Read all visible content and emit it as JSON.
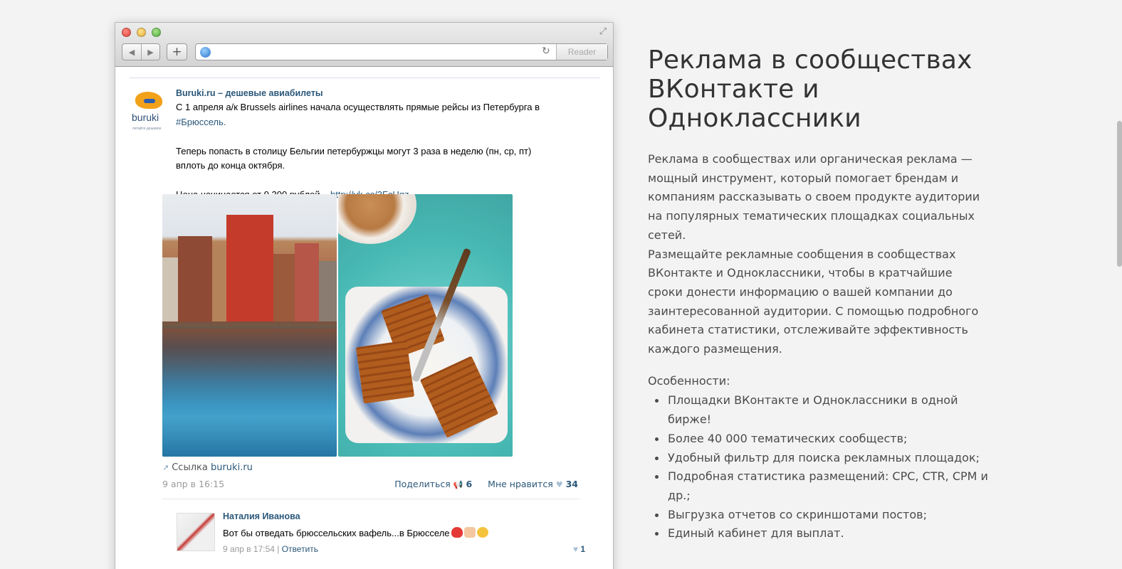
{
  "browser": {
    "reader_label": "Reader",
    "reload_icon": "reload-icon",
    "globe_icon": "globe-icon"
  },
  "post": {
    "author": "Buruki.ru – дешевые авиабилеты",
    "avatar_text": "buruki",
    "avatar_subtext": "летайте дешевле",
    "line1": "С 1 апреля а/к Brussels airlines начала осуществлять прямые рейсы из Петербурга в",
    "hashtag": "#Брюссель.",
    "line2a": "Теперь попасть в столицу Бельгии петербуржцы могут 3 раза в неделю (пн, ср, пт)",
    "line2b": "вплоть до конца октября.",
    "price_text": "Цена начинается от 9 300 рублей – ",
    "price_link": "http://vk.cc/3FcUqz",
    "link_label": "Ссылка ",
    "link_domain": "buruki.ru",
    "date": "9 апр в 16:15",
    "share_label": "Поделиться",
    "share_count": "6",
    "like_label": "Мне нравится",
    "like_count": "34"
  },
  "comment": {
    "author": "Наталия Иванова",
    "text": "Вот бы отведать брюссельских вафель...в Брюсселе",
    "date": "9 апр в 17:54 | ",
    "reply_label": "Ответить",
    "like_count": "1"
  },
  "content": {
    "title": "Реклама в сообществах ВКонтакте и Одноклассники",
    "paragraph1": "Реклама в сообществах или органическая реклама — мощный инструмент, который помогает брендам и компаниям рассказывать о своем продукте аудитории на популярных тематических площадках социальных сетей.",
    "paragraph2": "Размещайте рекламные сообщения в сообществах ВКонтакте и Одноклассники, чтобы в кратчайшие сроки донести информацию о вашей компании до заинтересованной аудитории. С помощью подробного кабинета статистики, отслеживайте эффективность каждого размещения.",
    "features_title": "Особенности:",
    "features": [
      "Площадки ВКонтакте и Одноклассники в одной бирже!",
      "Более 40 000 тематических сообществ;",
      "Удобный фильтр для поиска рекламных площадок;",
      "Подробная статистика размещений: CPC, CTR, CPM и др.;",
      "Выгрузка отчетов со скриншотами постов;",
      "Единый кабинет для выплат."
    ]
  }
}
